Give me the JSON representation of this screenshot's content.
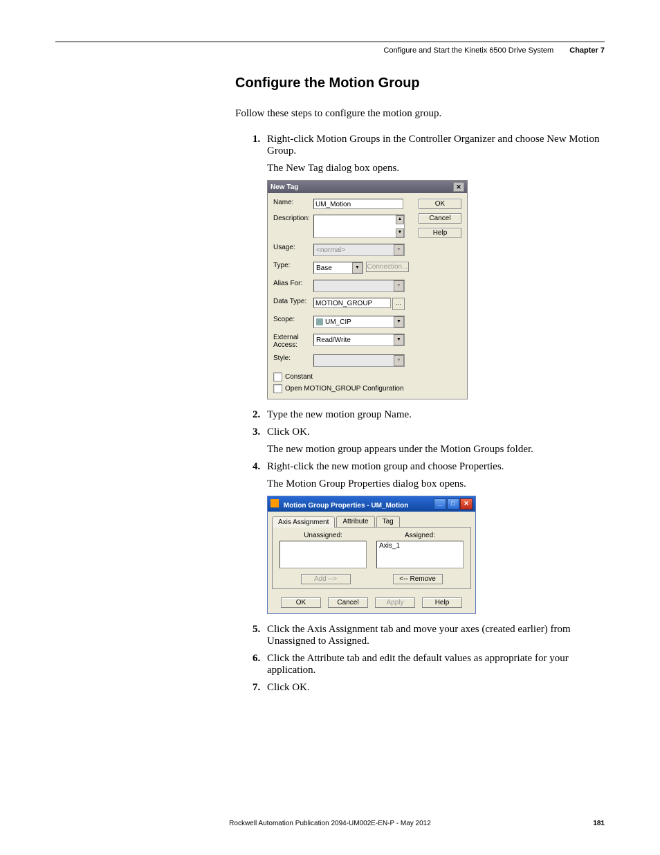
{
  "header": {
    "title": "Configure and Start the Kinetix 6500 Drive System",
    "chapter": "Chapter 7"
  },
  "section_title": "Configure the Motion Group",
  "intro": "Follow these steps to configure the motion group.",
  "steps": {
    "s1": "Right-click Motion Groups in the Controller Organizer and choose New Motion Group.",
    "s1_sub": "The New Tag dialog box opens.",
    "s2": "Type the new motion group Name.",
    "s3": "Click OK.",
    "s3_sub": "The new motion group appears under the Motion Groups folder.",
    "s4": "Right-click the new motion group and choose Properties.",
    "s4_sub": "The Motion Group Properties dialog box opens.",
    "s5": "Click the Axis Assignment tab and move your axes (created earlier) from Unassigned to Assigned.",
    "s6": "Click the Attribute tab and edit the default values as appropriate for your application.",
    "s7": "Click OK."
  },
  "dialog1": {
    "title": "New Tag",
    "close": "✕",
    "labels": {
      "name": "Name:",
      "description": "Description:",
      "usage": "Usage:",
      "type": "Type:",
      "alias_for": "Alias For:",
      "data_type": "Data Type:",
      "scope": "Scope:",
      "external_access": "External Access:",
      "style": "Style:"
    },
    "values": {
      "name": "UM_Motion",
      "usage": "<normal>",
      "type": "Base",
      "alias_for": "",
      "data_type": "MOTION_GROUP",
      "scope": "UM_CIP",
      "external_access": "Read/Write",
      "style": ""
    },
    "buttons": {
      "ok": "OK",
      "cancel": "Cancel",
      "help": "Help",
      "connection": "Connection...",
      "ellipsis": "..."
    },
    "checkboxes": {
      "constant": "Constant",
      "open_config": "Open MOTION_GROUP Configuration"
    }
  },
  "dialog2": {
    "title": "Motion Group Properties - UM_Motion",
    "tabs": {
      "axis_assignment": "Axis Assignment",
      "attribute": "Attribute",
      "tag": "Tag"
    },
    "col_labels": {
      "unassigned": "Unassigned:",
      "assigned": "Assigned:"
    },
    "assigned_item": "Axis_1",
    "buttons": {
      "add": "Add -->",
      "remove": "<-- Remove",
      "ok": "OK",
      "cancel": "Cancel",
      "apply": "Apply",
      "help": "Help"
    }
  },
  "footer": {
    "pub": "Rockwell Automation Publication 2094-UM002E-EN-P - May 2012",
    "page": "181"
  }
}
